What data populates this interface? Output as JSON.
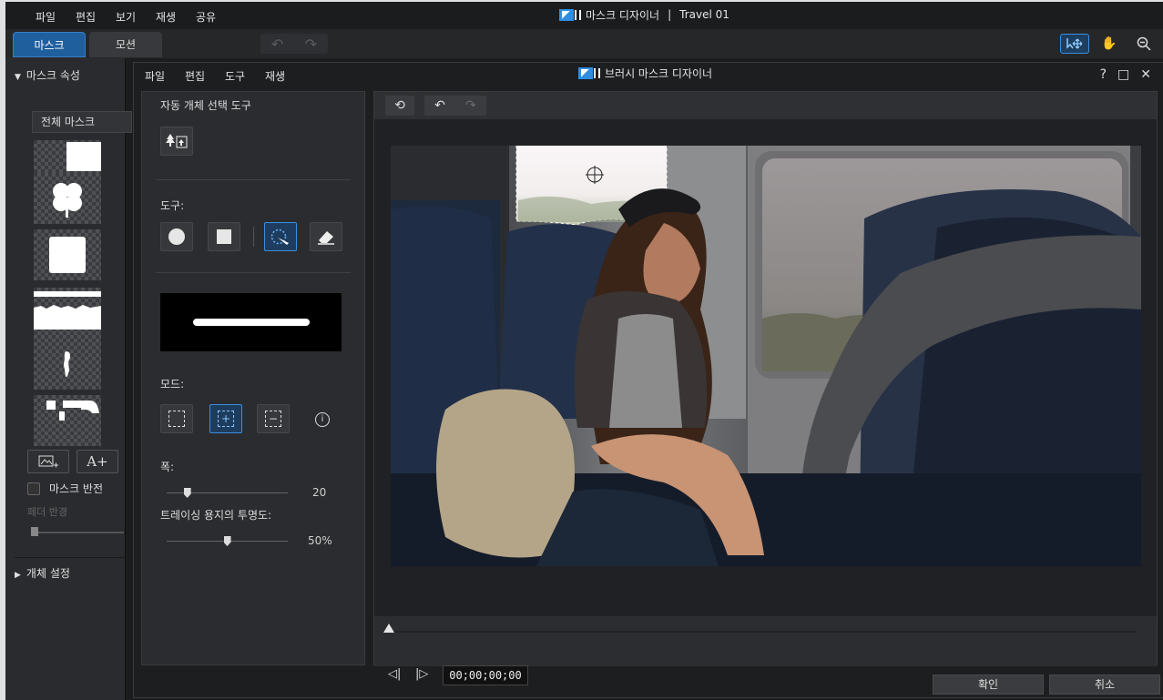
{
  "app": {
    "menu": [
      "파일",
      "편집",
      "보기",
      "재생",
      "공유"
    ],
    "title": "마스크 디자이너",
    "project": "Travel 01",
    "title_separator": "|"
  },
  "outer_tabs": {
    "mask": "마스크",
    "motion": "모션"
  },
  "outer_left": {
    "mask_props_header": "마스크 속성",
    "full_mask": "전체 마스크",
    "invert_label": "마스크 반전",
    "feather_label": "페더 반경",
    "object_settings": "개체 설정",
    "add_text_glyph": "A+"
  },
  "dialog": {
    "menu": [
      "파일",
      "편집",
      "도구",
      "재생"
    ],
    "title": "브러시 마스크 디자이너",
    "help": "?",
    "auto_select_label": "자동 개체 선택 도구",
    "tools_label": "도구:",
    "mode_label": "모드:",
    "width_label": "폭:",
    "width_value": "20",
    "width_fraction": 0.17,
    "opacity_label": "트레이싱 용지의 투명도:",
    "opacity_value": "50%",
    "opacity_fraction": 0.5,
    "timecode": "00;00;00;00",
    "ok": "확인",
    "cancel": "취소"
  },
  "colors": {
    "accent": "#3a8fe0",
    "active_tab": "#1f5f9e",
    "panel": "#2b2c2f",
    "background": "#1b1c1e"
  },
  "icons": [
    "auto-select-icon",
    "circle-brush-icon",
    "square-brush-icon",
    "smart-brush-icon",
    "eraser-icon",
    "info-icon",
    "reset-icon",
    "undo-icon",
    "redo-icon",
    "select-move-icon",
    "hand-icon",
    "zoom-out-icon"
  ]
}
